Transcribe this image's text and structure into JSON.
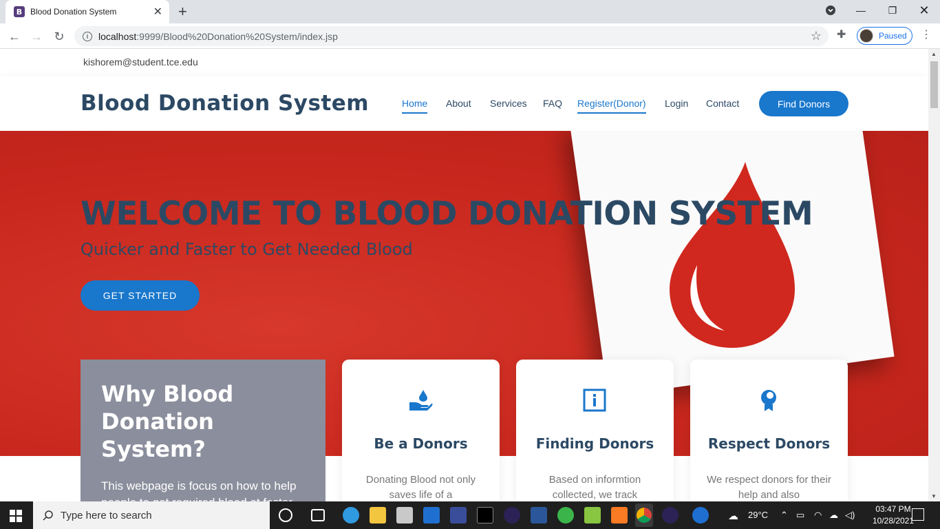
{
  "browser": {
    "tab_title": "Blood Donation System",
    "tab_favicon": "B",
    "url_host": "localhost",
    "url_rest": ":9999/Blood%20Donation%20System/index.jsp",
    "profile_status": "Paused"
  },
  "topbar": {
    "email": "kishorem@student.tce.edu"
  },
  "header": {
    "logo": "Blood Donation System",
    "nav": [
      "Home",
      "About",
      "Services",
      "FAQ",
      "Register(Donor)",
      "Login",
      "Contact"
    ],
    "cta": "Find Donors"
  },
  "hero": {
    "title": "WELCOME TO BLOOD DONATION SYSTEM",
    "subtitle": "Quicker and Faster to Get Needed Blood",
    "button": "GET STARTED"
  },
  "why": {
    "title_line1": "Why Blood",
    "title_line2": "Donation System?",
    "text": "This webpage is focus on how to help people to get required blood at faster rate to save people from emergency."
  },
  "cards": [
    {
      "icon": "donate-hand-icon",
      "title": "Be a Donors",
      "text": "Donating Blood not only saves life of a"
    },
    {
      "icon": "info-square-icon",
      "title": "Finding Donors",
      "text": "Based on informtion collected, we track"
    },
    {
      "icon": "award-medal-icon",
      "title": "Respect Donors",
      "text": "We respect donors for their help and also"
    }
  ],
  "taskbar": {
    "search_placeholder": "Type here to search",
    "weather": "29°C",
    "time": "03:47 PM",
    "date": "10/28/2021"
  },
  "colors": {
    "primary": "#1977cc",
    "heading": "#2c4964",
    "hero_red": "#c8271d"
  }
}
